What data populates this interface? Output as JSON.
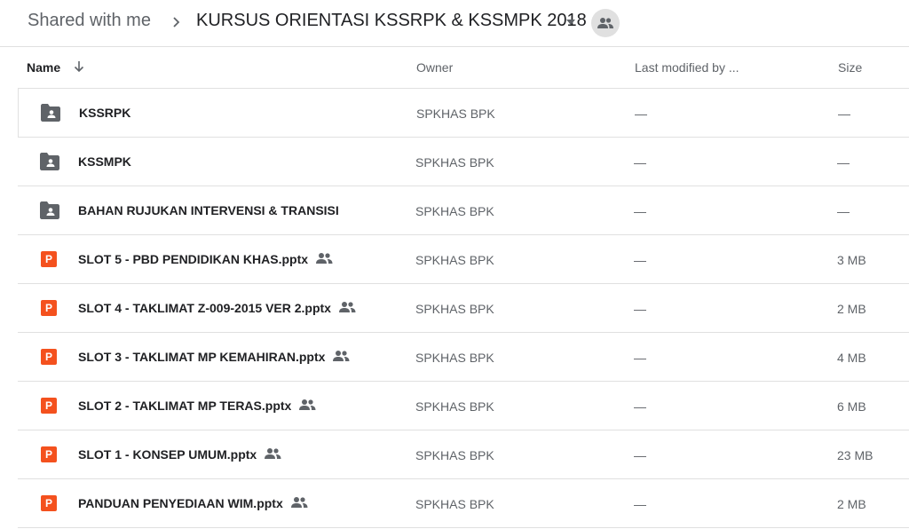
{
  "breadcrumb": {
    "root": "Shared with me",
    "current": "KURSUS ORIENTASI KSSRPK & KSSMPK 2018"
  },
  "columns": {
    "name": "Name",
    "owner": "Owner",
    "modified": "Last modified by ...",
    "size": "Size"
  },
  "colors": {
    "folder": "#5f6368",
    "pptx": "#f4511e",
    "divider": "#e0e0e0"
  },
  "ppt_letter": "P",
  "rows": [
    {
      "name": "KSSRPK",
      "type": "folder",
      "shared": false,
      "owner": "SPKHAS BPK",
      "modified": "—",
      "size": "—"
    },
    {
      "name": "KSSMPK",
      "type": "folder",
      "shared": false,
      "owner": "SPKHAS BPK",
      "modified": "—",
      "size": "—"
    },
    {
      "name": "BAHAN RUJUKAN INTERVENSI & TRANSISI",
      "type": "folder",
      "shared": false,
      "owner": "SPKHAS BPK",
      "modified": "—",
      "size": "—"
    },
    {
      "name": "SLOT 5 - PBD PENDIDIKAN KHAS.pptx",
      "type": "pptx",
      "shared": true,
      "owner": "SPKHAS BPK",
      "modified": "—",
      "size": "3 MB"
    },
    {
      "name": "SLOT 4 - TAKLIMAT Z-009-2015 VER 2.pptx",
      "type": "pptx",
      "shared": true,
      "owner": "SPKHAS BPK",
      "modified": "—",
      "size": "2 MB"
    },
    {
      "name": "SLOT 3 - TAKLIMAT MP KEMAHIRAN.pptx",
      "type": "pptx",
      "shared": true,
      "owner": "SPKHAS BPK",
      "modified": "—",
      "size": "4 MB"
    },
    {
      "name": "SLOT 2 - TAKLIMAT MP TERAS.pptx",
      "type": "pptx",
      "shared": true,
      "owner": "SPKHAS BPK",
      "modified": "—",
      "size": "6 MB"
    },
    {
      "name": "SLOT 1 - KONSEP UMUM.pptx",
      "type": "pptx",
      "shared": true,
      "owner": "SPKHAS BPK",
      "modified": "—",
      "size": "23 MB"
    },
    {
      "name": "PANDUAN PENYEDIAAN WIM.pptx",
      "type": "pptx",
      "shared": true,
      "owner": "SPKHAS BPK",
      "modified": "—",
      "size": "2 MB"
    }
  ]
}
